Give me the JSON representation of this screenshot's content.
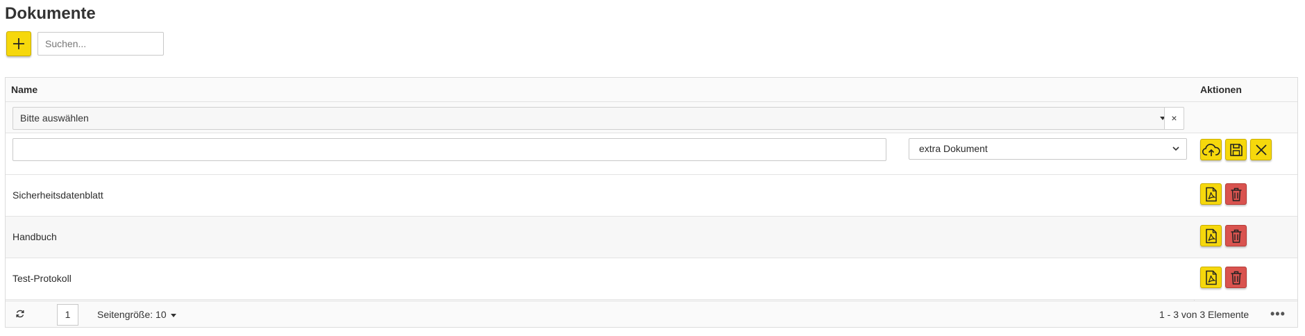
{
  "page": {
    "title": "Dokumente"
  },
  "toolbar": {
    "search_placeholder": "Suchen..."
  },
  "grid": {
    "columns": {
      "name": "Name",
      "actions": "Aktionen"
    },
    "filter": {
      "placeholder": "Bitte auswählen",
      "clear": "×"
    },
    "edit_row": {
      "name_value": "",
      "type_selected": "extra Dokument"
    },
    "rows": [
      {
        "name": "Sicherheitsdatenblatt"
      },
      {
        "name": "Handbuch"
      },
      {
        "name": "Test-Protokoll"
      }
    ]
  },
  "pager": {
    "current_page": "1",
    "page_size_label": "Seitengröße: 10",
    "items_info": "1 - 3 von 3 Elemente",
    "more": "•••"
  },
  "colors": {
    "accent": "#f6d80c",
    "danger": "#d9534f"
  },
  "icons": [
    "plus-icon",
    "cloud-upload-icon",
    "save-icon",
    "close-icon",
    "pdf-file-icon",
    "trash-icon",
    "refresh-icon",
    "chevron-down-icon",
    "ellipsis-icon"
  ]
}
